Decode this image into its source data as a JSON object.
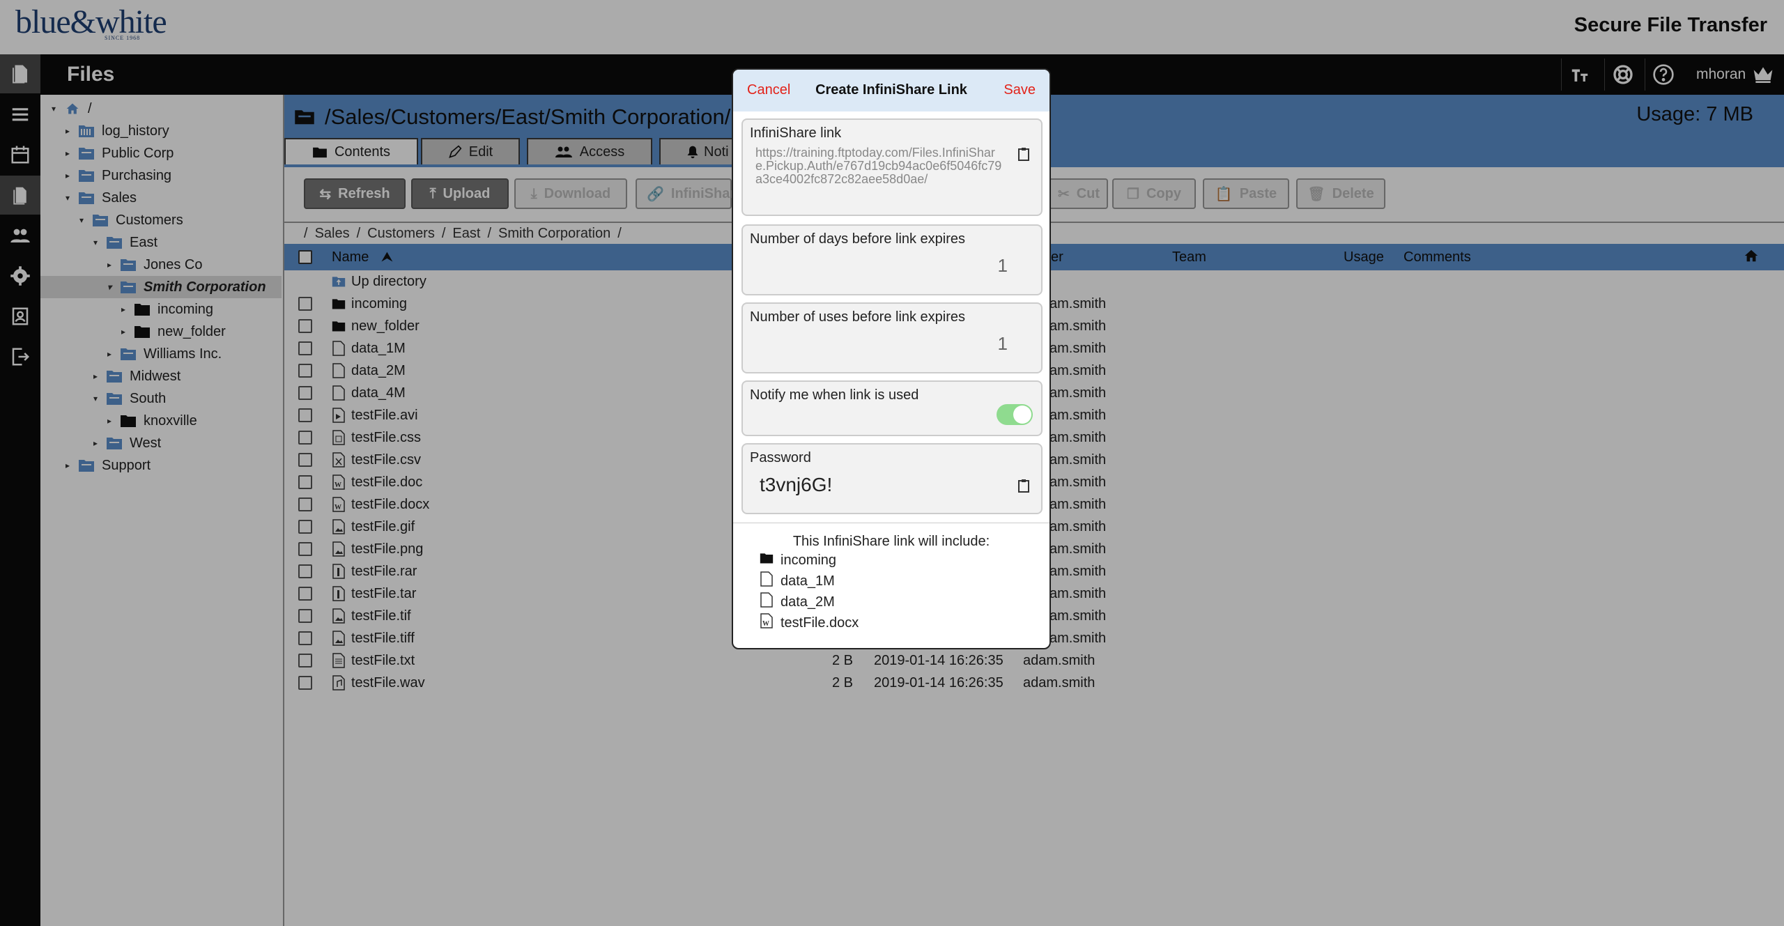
{
  "header": {
    "logo_text": "blue&white",
    "logo_since": "SINCE 1968",
    "app_title": "Secure File Transfer"
  },
  "titlebar": {
    "title": "Files",
    "username": "mhoran"
  },
  "tree": [
    {
      "label": "/",
      "indent": 0,
      "arrow": "▾",
      "icon": "home-icon"
    },
    {
      "label": "log_history",
      "indent": 1,
      "arrow": "▸",
      "icon": "log-folder-icon"
    },
    {
      "label": "Public Corp",
      "indent": 1,
      "arrow": "▸",
      "icon": "folder-icon"
    },
    {
      "label": "Purchasing",
      "indent": 1,
      "arrow": "▸",
      "icon": "folder-icon"
    },
    {
      "label": "Sales",
      "indent": 1,
      "arrow": "▾",
      "icon": "folder-icon"
    },
    {
      "label": "Customers",
      "indent": 2,
      "arrow": "▾",
      "icon": "folder-icon"
    },
    {
      "label": "East",
      "indent": 3,
      "arrow": "▾",
      "icon": "folder-icon"
    },
    {
      "label": "Jones Co",
      "indent": 4,
      "arrow": "▸",
      "icon": "folder-icon"
    },
    {
      "label": "Smith Corporation",
      "indent": 4,
      "arrow": "▾",
      "icon": "folder-icon",
      "selected": true
    },
    {
      "label": "incoming",
      "indent": 5,
      "arrow": "▸",
      "icon": "black-folder-icon"
    },
    {
      "label": "new_folder",
      "indent": 5,
      "arrow": "▸",
      "icon": "black-folder-icon"
    },
    {
      "label": "Williams Inc.",
      "indent": 4,
      "arrow": "▸",
      "icon": "folder-icon"
    },
    {
      "label": "Midwest",
      "indent": 3,
      "arrow": "▸",
      "icon": "folder-icon"
    },
    {
      "label": "South",
      "indent": 3,
      "arrow": "▾",
      "icon": "folder-icon"
    },
    {
      "label": "knoxville",
      "indent": 4,
      "arrow": "▸",
      "icon": "black-folder-icon"
    },
    {
      "label": "West",
      "indent": 3,
      "arrow": "▸",
      "icon": "folder-icon"
    },
    {
      "label": "Support",
      "indent": 1,
      "arrow": "▸",
      "icon": "folder-icon"
    }
  ],
  "main": {
    "path": "/Sales/Customers/East/Smith Corporation/",
    "usage": "Usage: 7 MB",
    "tabs": [
      {
        "label": "Contents",
        "icon": "folder-icon"
      },
      {
        "label": "Edit",
        "icon": "pencil-icon"
      },
      {
        "label": "Access",
        "icon": "users-icon"
      },
      {
        "label": "Noti",
        "icon": "bell-icon"
      }
    ],
    "toolbar": {
      "refresh": "Refresh",
      "upload": "Upload",
      "download": "Download",
      "infinishare": "InfiniShar",
      "cut": "Cut",
      "copy": "Copy",
      "paste": "Paste",
      "delete": "Delete"
    },
    "breadcrumb": [
      "/",
      "Sales",
      "/",
      "Customers",
      "/",
      "East",
      "/",
      "Smith Corporation",
      "/"
    ],
    "columns": {
      "name": "Name",
      "owner": "er",
      "team": "Team",
      "usage": "Usage",
      "comments": "Comments"
    },
    "files": [
      {
        "name": "Up directory",
        "icon": "up-folder-icon",
        "checkbox": false,
        "size": "",
        "date": "",
        "owner": ""
      },
      {
        "name": "incoming",
        "icon": "black-folder-icon",
        "checkbox": true,
        "size": "",
        "date": "",
        "owner": "am.smith"
      },
      {
        "name": "new_folder",
        "icon": "black-folder-icon",
        "checkbox": true,
        "size": "",
        "date": "",
        "owner": "am.smith"
      },
      {
        "name": "data_1M",
        "icon": "file-icon",
        "checkbox": true,
        "size": "",
        "date": "",
        "owner": "am.smith"
      },
      {
        "name": "data_2M",
        "icon": "file-icon",
        "checkbox": true,
        "size": "",
        "date": "",
        "owner": "am.smith"
      },
      {
        "name": "data_4M",
        "icon": "file-icon",
        "checkbox": true,
        "size": "",
        "date": "",
        "owner": "am.smith"
      },
      {
        "name": "testFile.avi",
        "icon": "video-file-icon",
        "checkbox": true,
        "size": "",
        "date": "",
        "owner": "am.smith"
      },
      {
        "name": "testFile.css",
        "icon": "code-file-icon",
        "checkbox": true,
        "size": "",
        "date": "",
        "owner": "am.smith"
      },
      {
        "name": "testFile.csv",
        "icon": "spreadsheet-file-icon",
        "checkbox": true,
        "size": "",
        "date": "",
        "owner": "am.smith"
      },
      {
        "name": "testFile.doc",
        "icon": "word-file-icon",
        "checkbox": true,
        "size": "",
        "date": "",
        "owner": "am.smith"
      },
      {
        "name": "testFile.docx",
        "icon": "word-file-icon",
        "checkbox": true,
        "size": "",
        "date": "",
        "owner": "am.smith"
      },
      {
        "name": "testFile.gif",
        "icon": "image-file-icon",
        "checkbox": true,
        "size": "",
        "date": "",
        "owner": "am.smith"
      },
      {
        "name": "testFile.png",
        "icon": "image-file-icon",
        "checkbox": true,
        "size": "",
        "date": "",
        "owner": "am.smith"
      },
      {
        "name": "testFile.rar",
        "icon": "archive-file-icon",
        "checkbox": true,
        "size": "",
        "date": "",
        "owner": "am.smith"
      },
      {
        "name": "testFile.tar",
        "icon": "archive-file-icon",
        "checkbox": true,
        "size": "",
        "date": "",
        "owner": "am.smith"
      },
      {
        "name": "testFile.tif",
        "icon": "image-file-icon",
        "checkbox": true,
        "size": "",
        "date": "",
        "owner": "am.smith"
      },
      {
        "name": "testFile.tiff",
        "icon": "image-file-icon",
        "checkbox": true,
        "size": "",
        "date": "",
        "owner": "am.smith"
      },
      {
        "name": "testFile.txt",
        "icon": "text-file-icon",
        "checkbox": true,
        "size": "2 B",
        "date": "2019-01-14 16:26:35",
        "owner": "adam.smith"
      },
      {
        "name": "testFile.wav",
        "icon": "audio-file-icon",
        "checkbox": true,
        "size": "2 B",
        "date": "2019-01-14 16:26:35",
        "owner": "adam.smith"
      }
    ]
  },
  "modal": {
    "cancel": "Cancel",
    "title": "Create InfiniShare Link",
    "save": "Save",
    "link_label": "InfiniShare link",
    "link_value": "https://training.ftptoday.com/Files.InfiniShare.Pickup.Auth/e767d19cb94ac0e6f5046fc79a3ce4002fc872c82aee58d0ae/",
    "days_label": "Number of days before link expires",
    "days_value": "1",
    "uses_label": "Number of uses before link expires",
    "uses_value": "1",
    "notify_label": "Notify me when link is used",
    "notify_on": true,
    "password_label": "Password",
    "password_value": "t3vnj6G!",
    "include_text": "This InfiniShare link will include:",
    "includes": [
      {
        "name": "incoming",
        "icon": "black-folder-icon"
      },
      {
        "name": "data_1M",
        "icon": "file-icon"
      },
      {
        "name": "data_2M",
        "icon": "file-icon"
      },
      {
        "name": "testFile.docx",
        "icon": "word-file-icon"
      }
    ]
  },
  "colors": {
    "accent_blue": "#5b8fcc",
    "modal_header": "#dce9f6",
    "action_red": "#e2231a",
    "toggle_green": "#8fdb8f"
  }
}
